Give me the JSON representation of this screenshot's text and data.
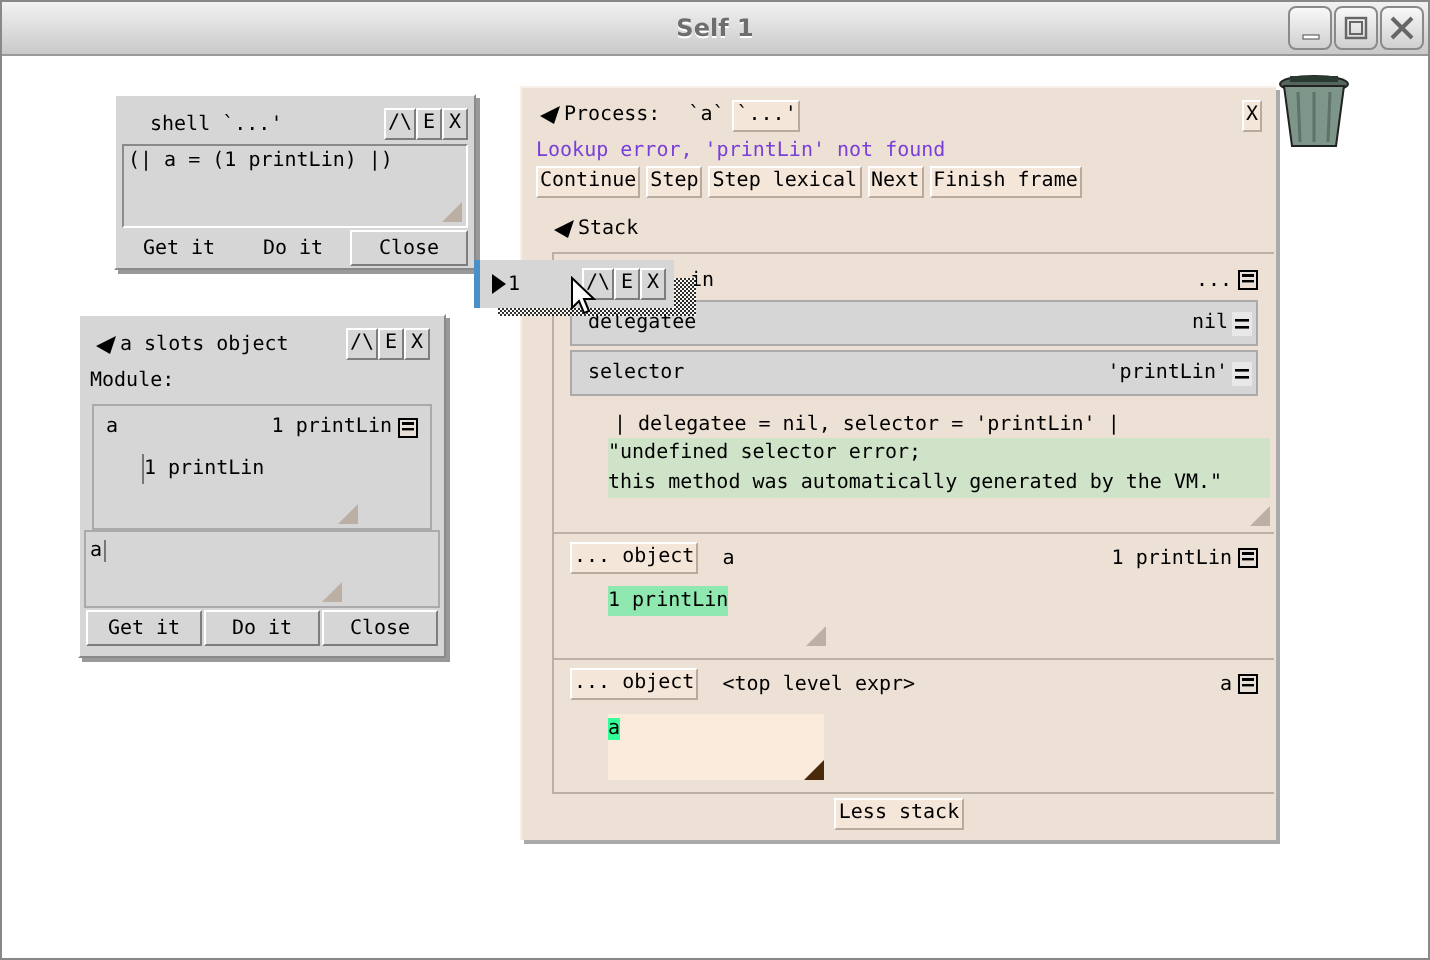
{
  "window": {
    "title": "Self 1"
  },
  "shell": {
    "title": "shell `...'",
    "controls": [
      "/\\",
      "E",
      "X"
    ],
    "code": "(| a = (1 printLin) |)",
    "buttons": [
      "Get it",
      "Do it",
      "Close"
    ]
  },
  "slots_object": {
    "title": "a slots object",
    "controls": [
      "/\\",
      "E",
      "X"
    ],
    "module_label": "Module:",
    "slot": {
      "name": "a",
      "value": "1 printLin",
      "code": "1 printLin"
    },
    "evaluator": "a",
    "buttons": [
      "Get it",
      "Do it",
      "Close"
    ]
  },
  "process": {
    "label": "Process:",
    "name": "`a`",
    "name_button": "`...'",
    "close": "X",
    "error": "Lookup error, 'printLin' not found",
    "buttons": [
      "Continue",
      "Step",
      "Step lexical",
      "Next",
      "Finish frame"
    ],
    "stack_label": "Stack",
    "frames": [
      {
        "kind": "method",
        "header": "in",
        "value": "...",
        "slots": [
          {
            "name": "delegatee",
            "value": "nil"
          },
          {
            "name": "selector",
            "value": "'printLin'"
          }
        ],
        "source": "| delegatee = nil, selector = 'printLin' |",
        "comment": [
          "\"undefined selector error;",
          "this method was automatically generated by the VM.\""
        ]
      },
      {
        "kind": "object",
        "button": "... object",
        "name": "a",
        "value": "1 printLin",
        "code": "1 printLin"
      },
      {
        "kind": "top",
        "button": "... object",
        "name": "<top level expr>",
        "value": "a",
        "code": "a"
      }
    ],
    "less_stack": "Less stack"
  },
  "drag_morph": {
    "label": "1",
    "controls": [
      "/\\",
      "E",
      "X"
    ]
  }
}
